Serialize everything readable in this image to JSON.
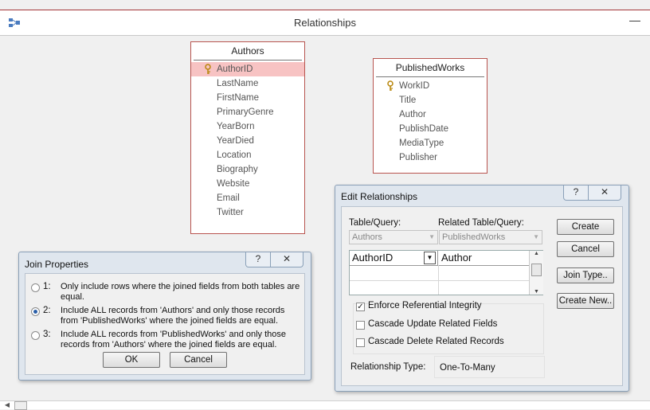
{
  "window": {
    "title": "Relationships",
    "minimize_glyph": "—",
    "icon": "relationships-icon"
  },
  "authors_table": {
    "title": "Authors",
    "fields": [
      "AuthorID",
      "LastName",
      "FirstName",
      "PrimaryGenre",
      "YearBorn",
      "YearDied",
      "Location",
      "Biography",
      "Website",
      "Email",
      "Twitter"
    ],
    "key_field": "AuthorID"
  },
  "works_table": {
    "title": "PublishedWorks",
    "fields": [
      "WorkID",
      "Title",
      "Author",
      "PublishDate",
      "MediaType",
      "Publisher"
    ],
    "key_field": "WorkID"
  },
  "join_dialog": {
    "title": "Join Properties",
    "help": "?",
    "close": "✕",
    "options": [
      {
        "num": "1:",
        "line1": "Only include rows where the joined fields from both tables are",
        "line2": "equal.",
        "selected": false
      },
      {
        "num": "2:",
        "line1": "Include ALL records from 'Authors' and only those records",
        "line2": "from 'PublishedWorks' where the joined fields are equal.",
        "selected": true
      },
      {
        "num": "3:",
        "line1": "Include ALL records from 'PublishedWorks' and only those",
        "line2": "records from 'Authors' where the joined fields are equal.",
        "selected": false
      }
    ],
    "ok": "OK",
    "cancel": "Cancel"
  },
  "edit_dialog": {
    "title": "Edit Relationships",
    "help": "?",
    "close": "✕",
    "table_query_label": "Table/Query:",
    "related_label": "Related Table/Query:",
    "table_value": "Authors",
    "related_value": "PublishedWorks",
    "grid_left": "AuthorID",
    "grid_right": "Author",
    "enforce_label": "Enforce Referential Integrity",
    "enforce_checked": true,
    "cascade_update_label": "Cascade Update Related Fields",
    "cascade_update_checked": false,
    "cascade_delete_label": "Cascade Delete Related Records",
    "cascade_delete_checked": false,
    "rel_type_label": "Relationship Type:",
    "rel_type_value": "One-To-Many",
    "buttons": {
      "create": "Create",
      "cancel": "Cancel",
      "join_type": "Join Type..",
      "create_new": "Create New.."
    }
  },
  "colors": {
    "accent": "#a4373a",
    "selected_row": "#f7c3c3",
    "dialog_bg": "#dfe6ee"
  }
}
